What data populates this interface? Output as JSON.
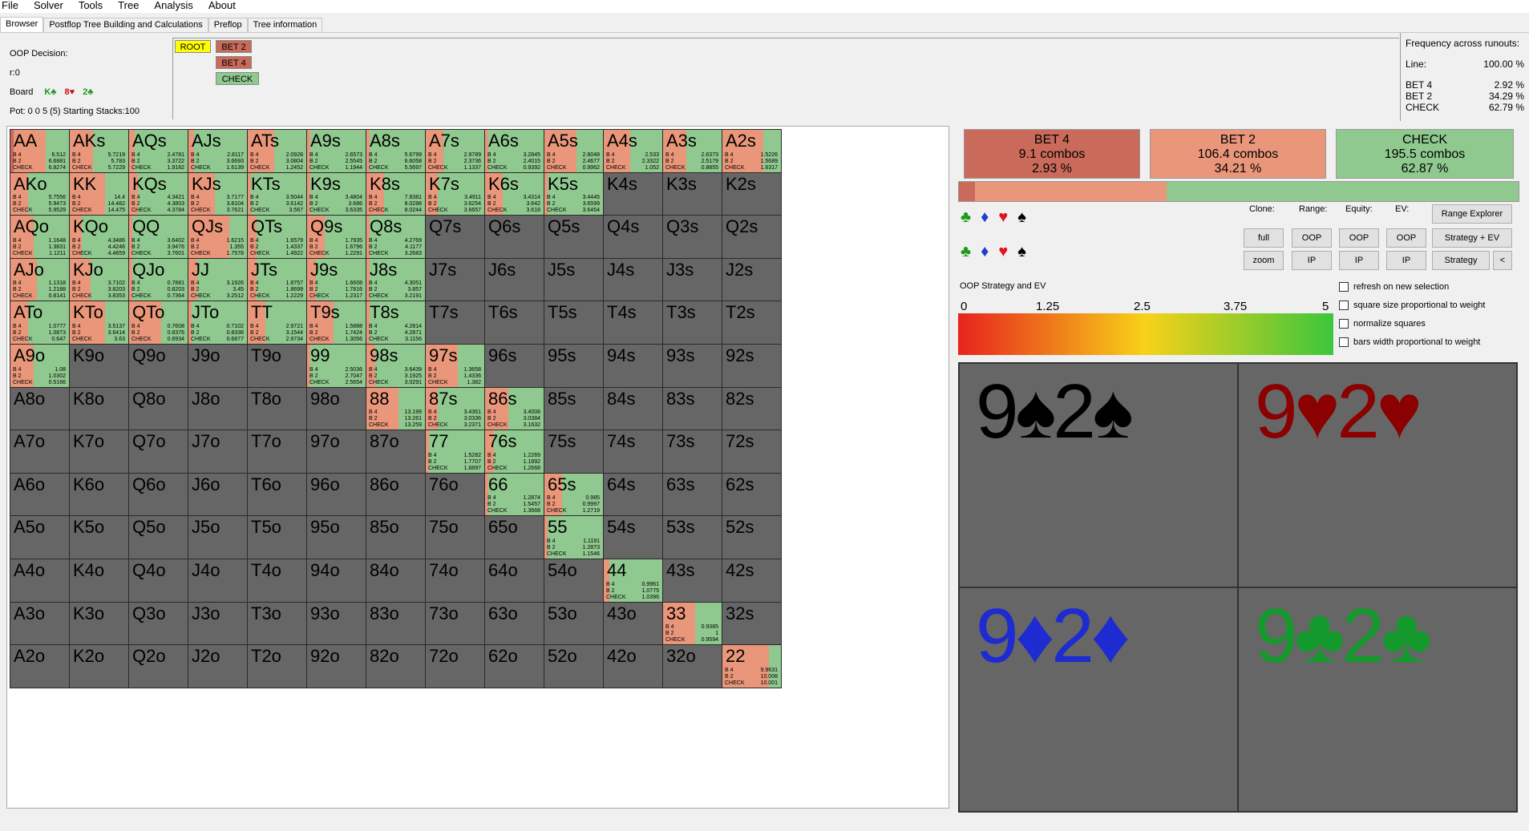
{
  "menu": [
    "File",
    "Solver",
    "Tools",
    "Tree",
    "Analysis",
    "About"
  ],
  "tabs": [
    "Browser",
    "Postflop Tree Building and Calculations",
    "Preflop",
    "Tree information"
  ],
  "decision": {
    "title": "OOP Decision:",
    "line": "r:0",
    "board_label": "Board",
    "board_cards": [
      {
        "text": "K♣",
        "color": "#1a9a1a"
      },
      {
        "text": "8♥",
        "color": "#cc1111"
      },
      {
        "text": "2♣",
        "color": "#1a9a1a"
      }
    ],
    "pot": "Pot: 0 0 5 (5) Starting Stacks:100"
  },
  "tree": {
    "root": "ROOT",
    "bet2": "BET 2",
    "bet4": "BET 4",
    "check": "CHECK"
  },
  "freq": {
    "title": "Frequency across runouts:",
    "line_label": "Line:",
    "line_value": "100.00 %",
    "rows": [
      {
        "label": "BET 4",
        "value": "2.92 %"
      },
      {
        "label": "BET 2",
        "value": "34.29 %"
      },
      {
        "label": "CHECK",
        "value": "62.79 %"
      }
    ]
  },
  "colors": {
    "bet4": "#c96a5a",
    "bet2": "#e9967a",
    "check": "#8fc98f",
    "empty": "#666666",
    "root": "#ffff00"
  },
  "hands": [
    [
      "AA",
      "AKs",
      "AQs",
      "AJs",
      "ATs",
      "A9s",
      "A8s",
      "A7s",
      "A6s",
      "A5s",
      "A4s",
      "A3s",
      "A2s"
    ],
    [
      "AKo",
      "KK",
      "KQs",
      "KJs",
      "KTs",
      "K9s",
      "K8s",
      "K7s",
      "K6s",
      "K5s",
      "K4s",
      "K3s",
      "K2s"
    ],
    [
      "AQo",
      "KQo",
      "QQ",
      "QJs",
      "QTs",
      "Q9s",
      "Q8s",
      "Q7s",
      "Q6s",
      "Q5s",
      "Q4s",
      "Q3s",
      "Q2s"
    ],
    [
      "AJo",
      "KJo",
      "QJo",
      "JJ",
      "JTs",
      "J9s",
      "J8s",
      "J7s",
      "J6s",
      "J5s",
      "J4s",
      "J3s",
      "J2s"
    ],
    [
      "ATo",
      "KTo",
      "QTo",
      "JTo",
      "TT",
      "T9s",
      "T8s",
      "T7s",
      "T6s",
      "T5s",
      "T4s",
      "T3s",
      "T2s"
    ],
    [
      "A9o",
      "K9o",
      "Q9o",
      "J9o",
      "T9o",
      "99",
      "98s",
      "97s",
      "96s",
      "95s",
      "94s",
      "93s",
      "92s"
    ],
    [
      "A8o",
      "K8o",
      "Q8o",
      "J8o",
      "T8o",
      "98o",
      "88",
      "87s",
      "86s",
      "85s",
      "84s",
      "83s",
      "82s"
    ],
    [
      "A7o",
      "K7o",
      "Q7o",
      "J7o",
      "T7o",
      "97o",
      "87o",
      "77",
      "76s",
      "75s",
      "74s",
      "73s",
      "72s"
    ],
    [
      "A6o",
      "K6o",
      "Q6o",
      "J6o",
      "T6o",
      "96o",
      "86o",
      "76o",
      "66",
      "65s",
      "64s",
      "63s",
      "62s"
    ],
    [
      "A5o",
      "K5o",
      "Q5o",
      "J5o",
      "T5o",
      "95o",
      "85o",
      "75o",
      "65o",
      "55",
      "54s",
      "53s",
      "52s"
    ],
    [
      "A4o",
      "K4o",
      "Q4o",
      "J4o",
      "T4o",
      "94o",
      "84o",
      "74o",
      "64o",
      "54o",
      "44",
      "43s",
      "42s"
    ],
    [
      "A3o",
      "K3o",
      "Q3o",
      "J3o",
      "T3o",
      "93o",
      "83o",
      "73o",
      "63o",
      "53o",
      "43o",
      "33",
      "32s"
    ],
    [
      "A2o",
      "K2o",
      "Q2o",
      "J2o",
      "T2o",
      "92o",
      "82o",
      "72o",
      "62o",
      "52o",
      "42o",
      "32o",
      "22"
    ]
  ],
  "strategy": {
    "AA": {
      "f": [
        0.05,
        0.55,
        0.4
      ],
      "ev": [
        "6.512",
        "6.6881",
        "6.8274"
      ]
    },
    "AKs": {
      "f": [
        0.0,
        0.4,
        0.6
      ],
      "ev": [
        "5.7219",
        "5.783",
        "5.7229"
      ]
    },
    "AQs": {
      "f": [
        0.0,
        0.1,
        0.9
      ],
      "ev": [
        "2.4781",
        "3.3722",
        "1.9182"
      ]
    },
    "AJs": {
      "f": [
        0.0,
        0.1,
        0.9
      ],
      "ev": [
        "2.8117",
        "3.6693",
        "1.6139"
      ]
    },
    "ATs": {
      "f": [
        0.0,
        0.45,
        0.55
      ],
      "ev": [
        "2.0928",
        "3.0804",
        "1.2452"
      ]
    },
    "A9s": {
      "f": [
        0.0,
        0.05,
        0.95
      ],
      "ev": [
        "2.6573",
        "2.5545",
        "1.1944"
      ]
    },
    "A8s": {
      "f": [
        0.0,
        0.05,
        0.95
      ],
      "ev": [
        "5.6799",
        "6.6058",
        "5.5697"
      ]
    },
    "A7s": {
      "f": [
        0.0,
        0.3,
        0.7
      ],
      "ev": [
        "2.9789",
        "2.3736",
        "1.1337"
      ]
    },
    "A6s": {
      "f": [
        0.0,
        0.05,
        0.95
      ],
      "ev": [
        "3.2845",
        "2.4015",
        "0.9392"
      ]
    },
    "A5s": {
      "f": [
        0.0,
        0.55,
        0.45
      ],
      "ev": [
        "2.8048",
        "2.4677",
        "0.9962"
      ]
    },
    "A4s": {
      "f": [
        0.0,
        0.45,
        0.55
      ],
      "ev": [
        "2.533",
        "2.3322",
        "1.052"
      ]
    },
    "A3s": {
      "f": [
        0.0,
        0.4,
        0.6
      ],
      "ev": [
        "2.6373",
        "2.5179",
        "0.8855"
      ]
    },
    "A2s": {
      "f": [
        0.0,
        0.7,
        0.3
      ],
      "ev": [
        "1.5226",
        "1.5689",
        "1.6317"
      ]
    },
    "AKo": {
      "f": [
        0.0,
        0.3,
        0.7
      ],
      "ev": [
        "5.7556",
        "5.9473",
        "5.9529"
      ]
    },
    "KK": {
      "f": [
        0.0,
        0.6,
        0.4
      ],
      "ev": [
        "14.4",
        "14.482",
        "14.475"
      ]
    },
    "KQs": {
      "f": [
        0.0,
        0.15,
        0.85
      ],
      "ev": [
        "4.3421",
        "4.3803",
        "4.3784"
      ]
    },
    "KJs": {
      "f": [
        0.0,
        0.45,
        0.55
      ],
      "ev": [
        "3.7177",
        "3.8104",
        "3.7621"
      ]
    },
    "KTs": {
      "f": [
        0.0,
        0.05,
        0.95
      ],
      "ev": [
        "3.5044",
        "3.6142",
        "3.567"
      ]
    },
    "K9s": {
      "f": [
        0.0,
        0.05,
        0.95
      ],
      "ev": [
        "3.4804",
        "3.686",
        "3.6335"
      ]
    },
    "K8s": {
      "f": [
        0.0,
        0.3,
        0.7
      ],
      "ev": [
        "7.9381",
        "8.0288",
        "8.0244"
      ]
    },
    "K7s": {
      "f": [
        0.0,
        0.2,
        0.8
      ],
      "ev": [
        "3.4911",
        "3.6254",
        "3.6657"
      ]
    },
    "K6s": {
      "f": [
        0.0,
        0.3,
        0.7
      ],
      "ev": [
        "3.4314",
        "3.642",
        "3.618"
      ]
    },
    "K5s": {
      "f": [
        0.0,
        0.05,
        0.95
      ],
      "ev": [
        "3.4445",
        "3.6599",
        "3.6454"
      ]
    },
    "AQo": {
      "f": [
        0.0,
        0.4,
        0.6
      ],
      "ev": [
        "1.1648",
        "1.3831",
        "1.1211"
      ]
    },
    "KQo": {
      "f": [
        0.0,
        0.2,
        0.8
      ],
      "ev": [
        "4.3486",
        "4.4246",
        "4.4659"
      ]
    },
    "QQ": {
      "f": [
        0.0,
        0.05,
        0.95
      ],
      "ev": [
        "3.6402",
        "3.9476",
        "3.7601"
      ]
    },
    "QJs": {
      "f": [
        0.0,
        0.7,
        0.3
      ],
      "ev": [
        "1.6215",
        "1.355",
        "1.7578"
      ]
    },
    "QTs": {
      "f": [
        0.0,
        0.15,
        0.85
      ],
      "ev": [
        "1.6579",
        "1.4337",
        "1.4922"
      ]
    },
    "Q9s": {
      "f": [
        0.0,
        0.3,
        0.7
      ],
      "ev": [
        "1.7935",
        "1.6796",
        "1.2291"
      ]
    },
    "Q8s": {
      "f": [
        0.0,
        0.05,
        0.95
      ],
      "ev": [
        "4.2769",
        "4.1177",
        "3.2683"
      ]
    },
    "AJo": {
      "f": [
        0.0,
        0.45,
        0.55
      ],
      "ev": [
        "1.1318",
        "1.2188",
        "0.8141"
      ]
    },
    "KJo": {
      "f": [
        0.0,
        0.35,
        0.65
      ],
      "ev": [
        "3.7102",
        "3.8203",
        "3.8353"
      ]
    },
    "QJo": {
      "f": [
        0.0,
        0.05,
        0.95
      ],
      "ev": [
        "0.7881",
        "0.8203",
        "0.7364"
      ]
    },
    "JJ": {
      "f": [
        0.0,
        0.15,
        0.85
      ],
      "ev": [
        "3.1926",
        "3.45",
        "3.2512"
      ]
    },
    "JTs": {
      "f": [
        0.0,
        0.15,
        0.85
      ],
      "ev": [
        "1.8757",
        "1.8699",
        "1.2229"
      ]
    },
    "J9s": {
      "f": [
        0.0,
        0.15,
        0.85
      ],
      "ev": [
        "1.6608",
        "1.7816",
        "1.2317"
      ]
    },
    "J8s": {
      "f": [
        0.0,
        0.05,
        0.95
      ],
      "ev": [
        "4.3051",
        "3.857",
        "3.2191"
      ]
    },
    "ATo": {
      "f": [
        0.0,
        0.3,
        0.7
      ],
      "ev": [
        "1.0777",
        "1.0873",
        "0.647"
      ]
    },
    "KTo": {
      "f": [
        0.0,
        0.6,
        0.4
      ],
      "ev": [
        "3.5137",
        "3.6414",
        "3.63"
      ]
    },
    "QTo": {
      "f": [
        0.0,
        0.55,
        0.45
      ],
      "ev": [
        "0.7608",
        "0.8376",
        "0.6934"
      ]
    },
    "JTo": {
      "f": [
        0.0,
        0.05,
        0.95
      ],
      "ev": [
        "0.7102",
        "0.8336",
        "0.6877"
      ]
    },
    "TT": {
      "f": [
        0.0,
        0.3,
        0.7
      ],
      "ev": [
        "2.9721",
        "3.1544",
        "2.9734"
      ]
    },
    "T9s": {
      "f": [
        0.0,
        0.45,
        0.55
      ],
      "ev": [
        "1.5888",
        "1.7424",
        "1.3056"
      ]
    },
    "T8s": {
      "f": [
        0.0,
        0.05,
        0.95
      ],
      "ev": [
        "4.2814",
        "4.2871",
        "3.1156"
      ]
    },
    "A9o": {
      "f": [
        0.0,
        0.4,
        0.6
      ],
      "ev": [
        "1.08",
        "1.0302",
        "0.5166"
      ]
    },
    "99": {
      "f": [
        0.0,
        0.05,
        0.95
      ],
      "ev": [
        "2.5036",
        "2.7047",
        "2.5654"
      ]
    },
    "98s": {
      "f": [
        0.0,
        0.15,
        0.85
      ],
      "ev": [
        "3.6439",
        "3.1925",
        "3.0291"
      ]
    },
    "97s": {
      "f": [
        0.0,
        0.55,
        0.45
      ],
      "ev": [
        "1.3658",
        "1.4336",
        "1.382"
      ]
    },
    "88": {
      "f": [
        0.0,
        0.55,
        0.45
      ],
      "ev": [
        "13.199",
        "13.261",
        "13.259"
      ]
    },
    "87s": {
      "f": [
        0.0,
        0.2,
        0.8
      ],
      "ev": [
        "3.4361",
        "3.0336",
        "3.2371"
      ]
    },
    "86s": {
      "f": [
        0.0,
        0.4,
        0.6
      ],
      "ev": [
        "3.4008",
        "3.0384",
        "3.1632"
      ]
    },
    "77": {
      "f": [
        0.0,
        0.05,
        0.95
      ],
      "ev": [
        "1.5282",
        "1.7707",
        "1.6897"
      ]
    },
    "76s": {
      "f": [
        0.0,
        0.15,
        0.85
      ],
      "ev": [
        "1.2269",
        "1.1892",
        "1.2668"
      ]
    },
    "66": {
      "f": [
        0.0,
        0.05,
        0.95
      ],
      "ev": [
        "1.2874",
        "1.5457",
        "1.3668"
      ]
    },
    "65s": {
      "f": [
        0.0,
        0.3,
        0.7
      ],
      "ev": [
        "0.985",
        "0.9997",
        "1.2719"
      ]
    },
    "55": {
      "f": [
        0.0,
        0.05,
        0.95
      ],
      "ev": [
        "1.1191",
        "1.2873",
        "1.1546"
      ]
    },
    "44": {
      "f": [
        0.0,
        0.1,
        0.9
      ],
      "ev": [
        "0.9961",
        "1.0775",
        "1.0396"
      ]
    },
    "33": {
      "f": [
        0.0,
        0.55,
        0.45
      ],
      "ev": [
        "0.9385",
        "1",
        "0.9594"
      ]
    },
    "22": {
      "f": [
        0.0,
        0.8,
        0.2
      ],
      "ev": [
        "9.9631",
        "10.008",
        "10.001"
      ]
    }
  },
  "mini_labels": [
    "B 4",
    "B 2",
    "CHECK"
  ],
  "summary": [
    {
      "label": "BET 4",
      "combos": "9.1 combos",
      "pct": "2.93 %"
    },
    {
      "label": "BET 2",
      "combos": "106.4 combos",
      "pct": "34.21 %"
    },
    {
      "label": "CHECK",
      "combos": "195.5 combos",
      "pct": "62.87 %"
    }
  ],
  "strip_fractions": [
    0.0293,
    0.3421,
    0.6287
  ],
  "controls": {
    "clone": "Clone:",
    "range": "Range:",
    "equity": "Equity:",
    "ev": "EV:",
    "full": "full",
    "zoom": "zoom",
    "oop": "OOP",
    "ip": "IP",
    "range_explorer": "Range Explorer",
    "strategy_ev": "Strategy + EV",
    "strategy": "Strategy",
    "back": "<"
  },
  "suits": [
    "♣",
    "♦",
    "♥",
    "♠"
  ],
  "suit_colors": [
    "#1a9a1a",
    "#1d3ed0",
    "#e0121b",
    "#000000"
  ],
  "checkboxes": [
    "refresh on new selection",
    "square size proportional to weight",
    "normalize squares",
    "bars width proportional to weight"
  ],
  "ev_section": {
    "title": "OOP Strategy and EV",
    "ticks": [
      "0",
      "1.25",
      "2.5",
      "3.75",
      "5"
    ]
  },
  "combos": [
    {
      "text": "9♠2♠",
      "color": "#000000"
    },
    {
      "text": "9♥2♥",
      "color": "#8b0000"
    },
    {
      "text": "9♦2♦",
      "color": "#1d2bd0"
    },
    {
      "text": "9♣2♣",
      "color": "#149a2c"
    }
  ]
}
